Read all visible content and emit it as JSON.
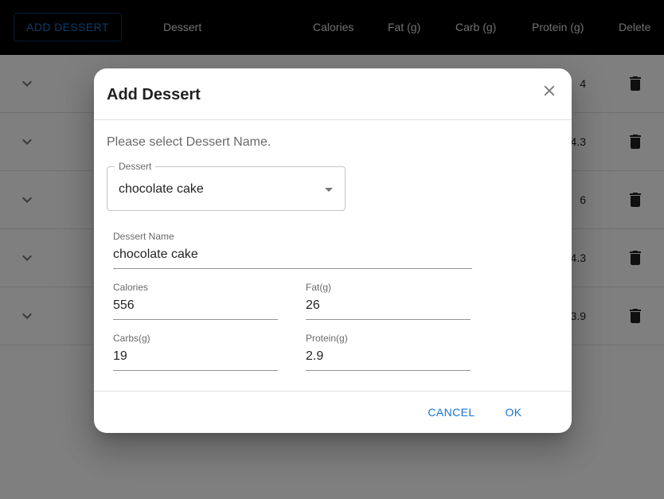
{
  "header": {
    "add_button": "ADD DESSERT",
    "columns": {
      "dessert": "Dessert",
      "calories": "Calories",
      "fat": "Fat (g)",
      "carb": "Carb (g)",
      "protein": "Protein (g)",
      "delete": "Delete"
    }
  },
  "rows": [
    {
      "protein": "4"
    },
    {
      "protein": "4.3"
    },
    {
      "protein": "6"
    },
    {
      "protein": "4.3"
    },
    {
      "protein": "3.9"
    }
  ],
  "dialog": {
    "title": "Add Dessert",
    "instruction": "Please select Dessert Name.",
    "select": {
      "label": "Dessert",
      "value": "chocolate cake"
    },
    "fields": {
      "dessert_name": {
        "label": "Dessert Name",
        "value": "chocolate cake"
      },
      "calories": {
        "label": "Calories",
        "value": "556"
      },
      "fat": {
        "label": "Fat(g)",
        "value": "26"
      },
      "carbs": {
        "label": "Carbs(g)",
        "value": "19"
      },
      "protein": {
        "label": "Protein(g)",
        "value": "2.9"
      }
    },
    "cancel_label": "CANCEL",
    "ok_label": "OK"
  },
  "colors": {
    "accent": "#1976d2",
    "header_bg": "#000000",
    "backdrop": "rgba(0,0,0,0.5)"
  },
  "icons": {
    "expand": "chevron-down-icon",
    "delete": "trash-icon",
    "close": "close-icon",
    "select": "caret-down-icon"
  }
}
